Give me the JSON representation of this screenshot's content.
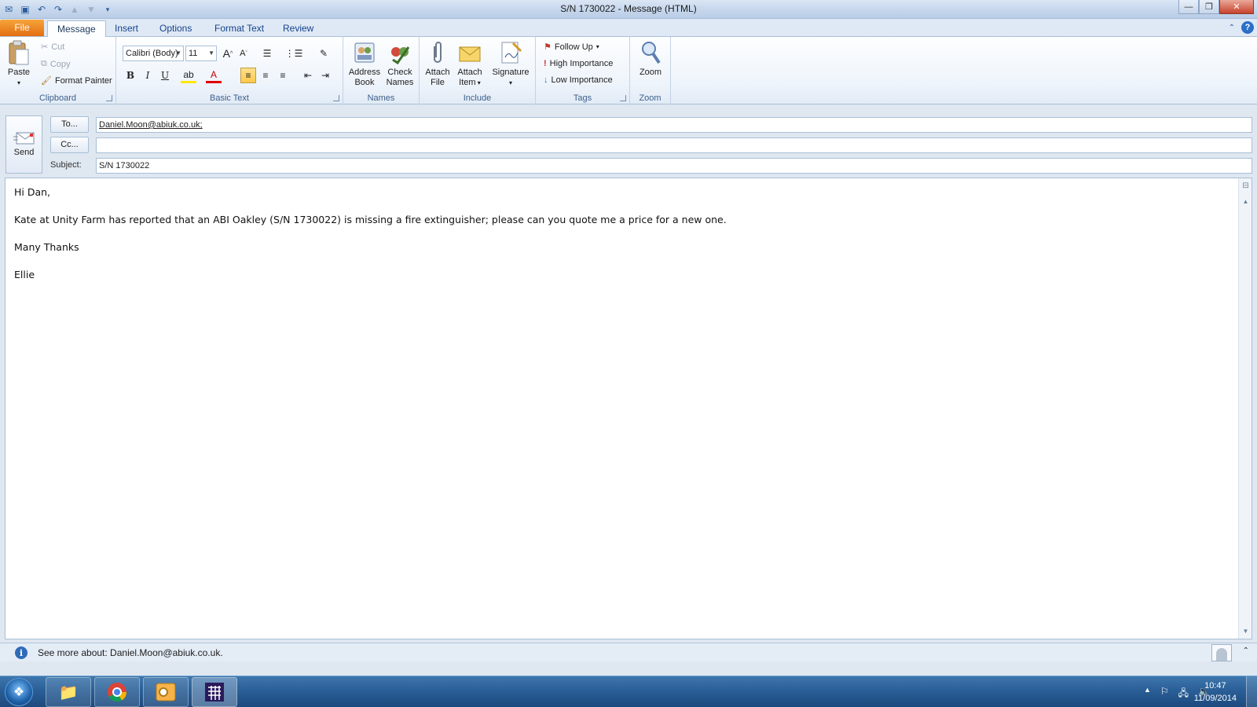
{
  "window": {
    "title": "S/N 1730022  -  Message (HTML)"
  },
  "tabs": [
    {
      "label": "File"
    },
    {
      "label": "Message"
    },
    {
      "label": "Insert"
    },
    {
      "label": "Options"
    },
    {
      "label": "Format Text"
    },
    {
      "label": "Review"
    }
  ],
  "ribbon": {
    "clipboard": {
      "label": "Clipboard",
      "paste": "Paste",
      "cut": "Cut",
      "copy": "Copy",
      "format_painter": "Format Painter"
    },
    "basic_text": {
      "label": "Basic Text",
      "font": "Calibri (Body)",
      "size": "11"
    },
    "names": {
      "label": "Names",
      "address_book_1": "Address",
      "address_book_2": "Book",
      "check_names_1": "Check",
      "check_names_2": "Names"
    },
    "include": {
      "label": "Include",
      "attach_file_1": "Attach",
      "attach_file_2": "File",
      "attach_item_1": "Attach",
      "attach_item_2": "Item",
      "signature": "Signature"
    },
    "tags": {
      "label": "Tags",
      "follow_up": "Follow Up",
      "high_importance": "High Importance",
      "low_importance": "Low Importance"
    },
    "zoom": {
      "label": "Zoom",
      "zoom": "Zoom"
    }
  },
  "header": {
    "send": "Send",
    "to_button": "To...",
    "cc_button": "Cc...",
    "subject_label": "Subject:",
    "to_value": "Daniel.Moon@abiuk.co.uk;",
    "cc_value": "",
    "subject_value": "S/N 1730022"
  },
  "message": {
    "lines": [
      "Hi Dan,",
      "Kate at Unity Farm has reported that an ABI Oakley (S/N 1730022) is missing a fire extinguisher; please can you quote me a price for a new one.",
      "Many Thanks",
      "Ellie"
    ]
  },
  "people_pane": {
    "text": "See more about: Daniel.Moon@abiuk.co.uk."
  },
  "taskbar": {
    "time": "10:47",
    "date": "11/09/2014"
  },
  "colors": {
    "file_tab": "#e36f12",
    "ribbon_text": "#15428b",
    "taskbar": "#2a5f97"
  }
}
